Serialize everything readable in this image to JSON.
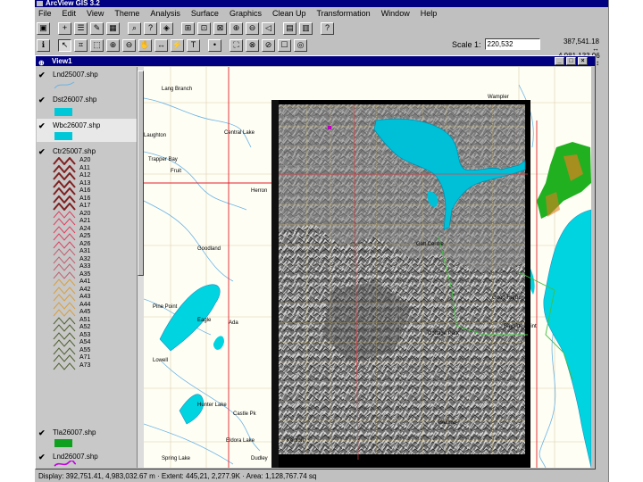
{
  "app": {
    "title": "ArcView GIS 3.2"
  },
  "menu": [
    "File",
    "Edit",
    "View",
    "Theme",
    "Analysis",
    "Surface",
    "Graphics",
    "Clean Up",
    "Transformation",
    "Window",
    "Help"
  ],
  "toolbar1": [
    {
      "name": "save-project-icon",
      "glyph": "▣"
    },
    {
      "name": "add-theme-icon",
      "glyph": "+"
    },
    {
      "name": "theme-properties-icon",
      "glyph": "☰"
    },
    {
      "name": "edit-legend-icon",
      "glyph": "✎"
    },
    {
      "name": "open-table-icon",
      "glyph": "▦"
    },
    {
      "name": "find-icon",
      "glyph": "⌕"
    },
    {
      "name": "locate-address-icon",
      "glyph": "?"
    },
    {
      "name": "query-builder-icon",
      "glyph": "◈"
    },
    {
      "name": "zoom-to-full-extent-icon",
      "glyph": "⊞"
    },
    {
      "name": "zoom-to-themes-icon",
      "glyph": "⊡"
    },
    {
      "name": "zoom-to-selected-icon",
      "glyph": "⊠"
    },
    {
      "name": "zoom-in-fixed-icon",
      "glyph": "⊕"
    },
    {
      "name": "zoom-out-fixed-icon",
      "glyph": "⊖"
    },
    {
      "name": "zoom-previous-icon",
      "glyph": "◁"
    },
    {
      "name": "select-features-graphic-icon",
      "glyph": "▤"
    },
    {
      "name": "clear-selection-icon",
      "glyph": "▥"
    },
    {
      "name": "help-icon",
      "glyph": "?"
    }
  ],
  "toolbar2": [
    {
      "name": "identify-icon",
      "glyph": "ℹ"
    },
    {
      "name": "pointer-icon",
      "glyph": "↖"
    },
    {
      "name": "vertex-edit-icon",
      "glyph": "⌗"
    },
    {
      "name": "select-feature-icon",
      "glyph": "⬚"
    },
    {
      "name": "zoom-in-icon",
      "glyph": "⊕"
    },
    {
      "name": "zoom-out-icon",
      "glyph": "⊖"
    },
    {
      "name": "pan-icon",
      "glyph": "✋"
    },
    {
      "name": "measure-icon",
      "glyph": "↔"
    },
    {
      "name": "hotlink-icon",
      "glyph": "⚡"
    },
    {
      "name": "text-tool-icon",
      "glyph": "T"
    },
    {
      "name": "draw-point-icon",
      "glyph": "•"
    },
    {
      "name": "snap-icon",
      "glyph": "⛶"
    },
    {
      "name": "split-icon",
      "glyph": "⊗"
    },
    {
      "name": "merge-icon",
      "glyph": "⊘"
    },
    {
      "name": "label-icon",
      "glyph": "☐"
    },
    {
      "name": "graphics-icon",
      "glyph": "◎"
    }
  ],
  "scale": {
    "label": "Scale 1:",
    "value": "220,532"
  },
  "coords": {
    "x": "387,541.18 ↔",
    "y": "4,981,133.96 ↕"
  },
  "view": {
    "title": "View1"
  },
  "themes": [
    {
      "name": "Lnd25007.shp",
      "checked": true
    },
    {
      "name": "Dst26007.shp",
      "checked": true,
      "fill": "#00c8d8"
    },
    {
      "name": "Wbc26007.shp",
      "checked": true,
      "fill": "#00c8d8"
    },
    {
      "name": "Ctr25007.shp",
      "checked": true
    },
    {
      "name": "Tla26007.shp",
      "checked": true,
      "fill": "#10a020"
    },
    {
      "name": "Lnd26007.shp",
      "checked": true
    }
  ],
  "legend": [
    {
      "label": "A20",
      "color": "#802020",
      "weight": 2
    },
    {
      "label": "A11",
      "color": "#802020",
      "weight": 2
    },
    {
      "label": "A12",
      "color": "#802020",
      "weight": 2
    },
    {
      "label": "A13",
      "color": "#802020",
      "weight": 2
    },
    {
      "label": "A16",
      "color": "#802020",
      "weight": 2
    },
    {
      "label": "A16",
      "color": "#802020",
      "weight": 2
    },
    {
      "label": "A17",
      "color": "#802020",
      "weight": 2
    },
    {
      "label": "A20",
      "color": "#e04060",
      "weight": 1
    },
    {
      "label": "A21",
      "color": "#e04060",
      "weight": 1
    },
    {
      "label": "A24",
      "color": "#e04060",
      "weight": 1
    },
    {
      "label": "A25",
      "color": "#e04060",
      "weight": 1
    },
    {
      "label": "A26",
      "color": "#e04060",
      "weight": 1
    },
    {
      "label": "A31",
      "color": "#c06070",
      "weight": 1
    },
    {
      "label": "A32",
      "color": "#c06070",
      "weight": 1
    },
    {
      "label": "A33",
      "color": "#c06070",
      "weight": 1
    },
    {
      "label": "A35",
      "color": "#c06070",
      "weight": 1
    },
    {
      "label": "A41",
      "color": "#d8a040",
      "weight": 1
    },
    {
      "label": "A42",
      "color": "#d8a040",
      "weight": 1
    },
    {
      "label": "A43",
      "color": "#d8a040",
      "weight": 1
    },
    {
      "label": "A44",
      "color": "#d8a040",
      "weight": 1
    },
    {
      "label": "A45",
      "color": "#d8a040",
      "weight": 1
    },
    {
      "label": "A51",
      "color": "#506030",
      "weight": 1
    },
    {
      "label": "A52",
      "color": "#506030",
      "weight": 1
    },
    {
      "label": "A53",
      "color": "#506030",
      "weight": 1
    },
    {
      "label": "A54",
      "color": "#506030",
      "weight": 1
    },
    {
      "label": "A55",
      "color": "#506030",
      "weight": 1
    },
    {
      "label": "A71",
      "color": "#506030",
      "weight": 1
    },
    {
      "label": "A73",
      "color": "#506030",
      "weight": 1
    }
  ],
  "map": {
    "labels": [
      "Lang Branch",
      "Laughton",
      "Trapper Bay",
      "Fruit",
      "Goodland",
      "Central Lake",
      "Herron",
      "Eagle",
      "Galt Centre",
      "Cottage Park",
      "Wampler",
      "Good Harbor",
      "Bayside Point",
      "Belding",
      "Pine Point",
      "Hunter Lake",
      "Sun Valley",
      "Eldora Lake",
      "Ada",
      "Lowell",
      "Castle Pk",
      "Dudley",
      "Spring Lake",
      "Kenton"
    ],
    "colors": {
      "water": "#00d4e0",
      "urban": "#20b020",
      "urbanDark": "#e08020",
      "road": "#d0c8a0",
      "stream": "#70b8e8",
      "hwy": "#e0202a"
    }
  },
  "status": {
    "text": "Display: 392,751.41, 4,983,032.67 m · Extent: 445,21, 2,277.9K · Area: 1,128,767.74 sq"
  }
}
